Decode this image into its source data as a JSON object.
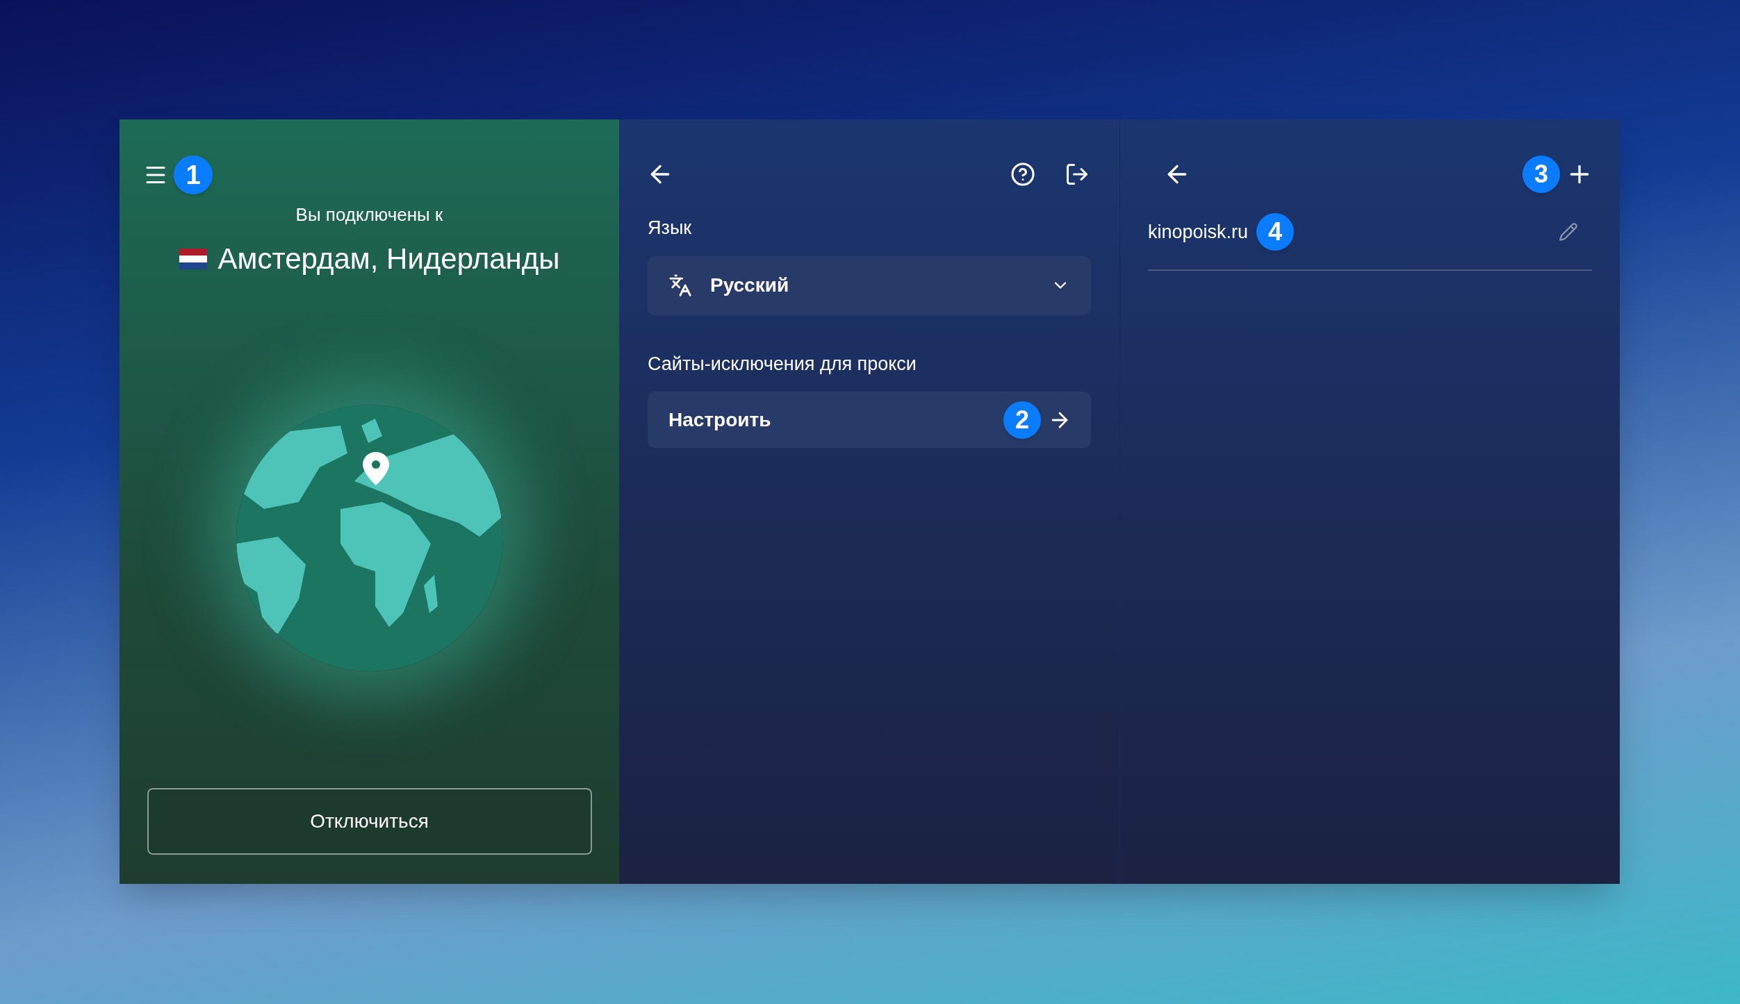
{
  "sidebar": {
    "menu_badge": "1",
    "status_text": "Вы подключены к",
    "location": "Амстердам, Нидерланды",
    "disconnect_button": "Отключиться"
  },
  "settings": {
    "language_label": "Язык",
    "language_select": {
      "value": "Русский"
    },
    "exclusions_label": "Сайты-исключения для прокси",
    "configure_button": {
      "label": "Настроить",
      "badge": "2"
    }
  },
  "exclusions": {
    "add_badge": "3",
    "sites": [
      {
        "domain": "kinopoisk.ru",
        "badge": "4"
      }
    ]
  }
}
